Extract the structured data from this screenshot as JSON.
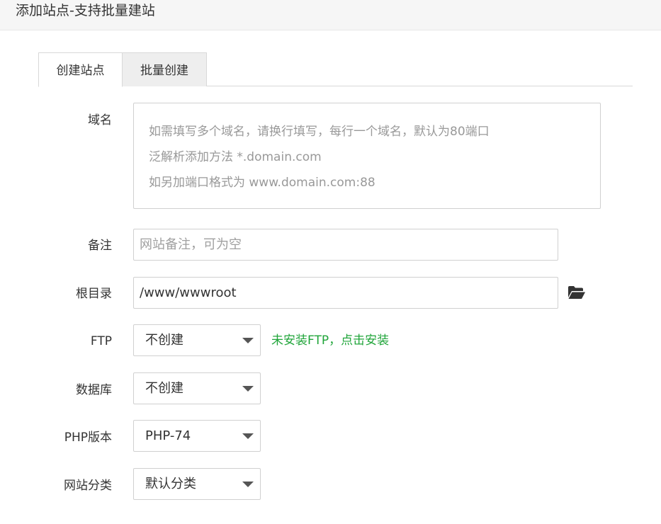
{
  "header": {
    "title": "添加站点-支持批量建站"
  },
  "tabs": [
    {
      "label": "创建站点",
      "active": true
    },
    {
      "label": "批量创建",
      "active": false
    }
  ],
  "form": {
    "domain": {
      "label": "域名",
      "placeholder_lines": [
        "如需填写多个域名，请换行填写，每行一个域名，默认为80端口",
        "泛解析添加方法 *.domain.com",
        "如另加端口格式为 www.domain.com:88"
      ]
    },
    "remark": {
      "label": "备注",
      "placeholder": "网站备注，可为空"
    },
    "root": {
      "label": "根目录",
      "value": "/www/wwwroot",
      "icon": "folder-open-icon"
    },
    "ftp": {
      "label": "FTP",
      "selected": "不创建",
      "hint": "未安装FTP，点击安装"
    },
    "database": {
      "label": "数据库",
      "selected": "不创建"
    },
    "php": {
      "label": "PHP版本",
      "selected": "PHP-74"
    },
    "category": {
      "label": "网站分类",
      "selected": "默认分类"
    }
  },
  "colors": {
    "link_green": "#20a53a",
    "placeholder": "#999999",
    "border": "#d0d0d0",
    "header_bg": "#f6f6f6"
  }
}
